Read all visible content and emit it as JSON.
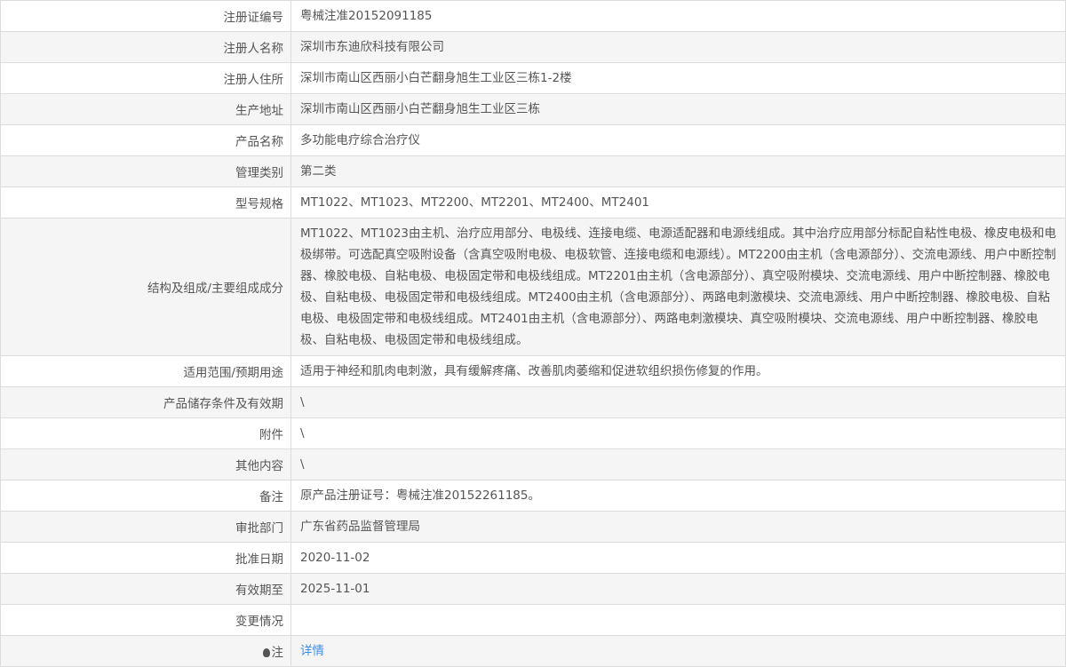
{
  "rows": [
    {
      "label": "注册证编号",
      "value": "粤械注准20152091185"
    },
    {
      "label": "注册人名称",
      "value": "深圳市东迪欣科技有限公司"
    },
    {
      "label": "注册人住所",
      "value": "深圳市南山区西丽小白芒翻身旭生工业区三栋1-2楼"
    },
    {
      "label": "生产地址",
      "value": "深圳市南山区西丽小白芒翻身旭生工业区三栋"
    },
    {
      "label": "产品名称",
      "value": "多功能电疗综合治疗仪"
    },
    {
      "label": "管理类别",
      "value": "第二类"
    },
    {
      "label": "型号规格",
      "value": "MT1022、MT1023、MT2200、MT2201、MT2400、MT2401"
    },
    {
      "label": "结构及组成/主要组成成分",
      "value": "MT1022、MT1023由主机、治疗应用部分、电极线、连接电缆、电源适配器和电源线组成。其中治疗应用部分标配自粘性电极、橡皮电极和电极绑带。可选配真空吸附设备（含真空吸附电极、电极软管、连接电缆和电源线）。MT2200由主机（含电源部分）、交流电源线、用户中断控制器、橡胶电极、自粘电极、电极固定带和电极线组成。MT2201由主机（含电源部分）、真空吸附模块、交流电源线、用户中断控制器、橡胶电极、自粘电极、电极固定带和电极线组成。MT2400由主机（含电源部分）、两路电刺激模块、交流电源线、用户中断控制器、橡胶电极、自粘电极、电极固定带和电极线组成。MT2401由主机（含电源部分）、两路电刺激模块、真空吸附模块、交流电源线、用户中断控制器、橡胶电极、自粘电极、电极固定带和电极线组成。"
    },
    {
      "label": "适用范围/预期用途",
      "value": "适用于神经和肌肉电刺激，具有缓解疼痛、改善肌肉萎缩和促进软组织损伤修复的作用。"
    },
    {
      "label": "产品储存条件及有效期",
      "value": "\\"
    },
    {
      "label": "附件",
      "value": "\\"
    },
    {
      "label": "其他内容",
      "value": "\\"
    },
    {
      "label": "备注",
      "value": "原产品注册证号：粤械注准20152261185。"
    },
    {
      "label": "审批部门",
      "value": "广东省药品监督管理局"
    },
    {
      "label": "批准日期",
      "value": "2020-11-02"
    },
    {
      "label": "有效期至",
      "value": "2025-11-01"
    },
    {
      "label": "变更情况",
      "value": ""
    }
  ],
  "note": {
    "label": "注",
    "link": "详情",
    "icon": "lightbulb-icon"
  },
  "colors": {
    "link": "#3a8ee6",
    "alt_row": "#f5f5f5",
    "border": "#dcdcdc"
  }
}
